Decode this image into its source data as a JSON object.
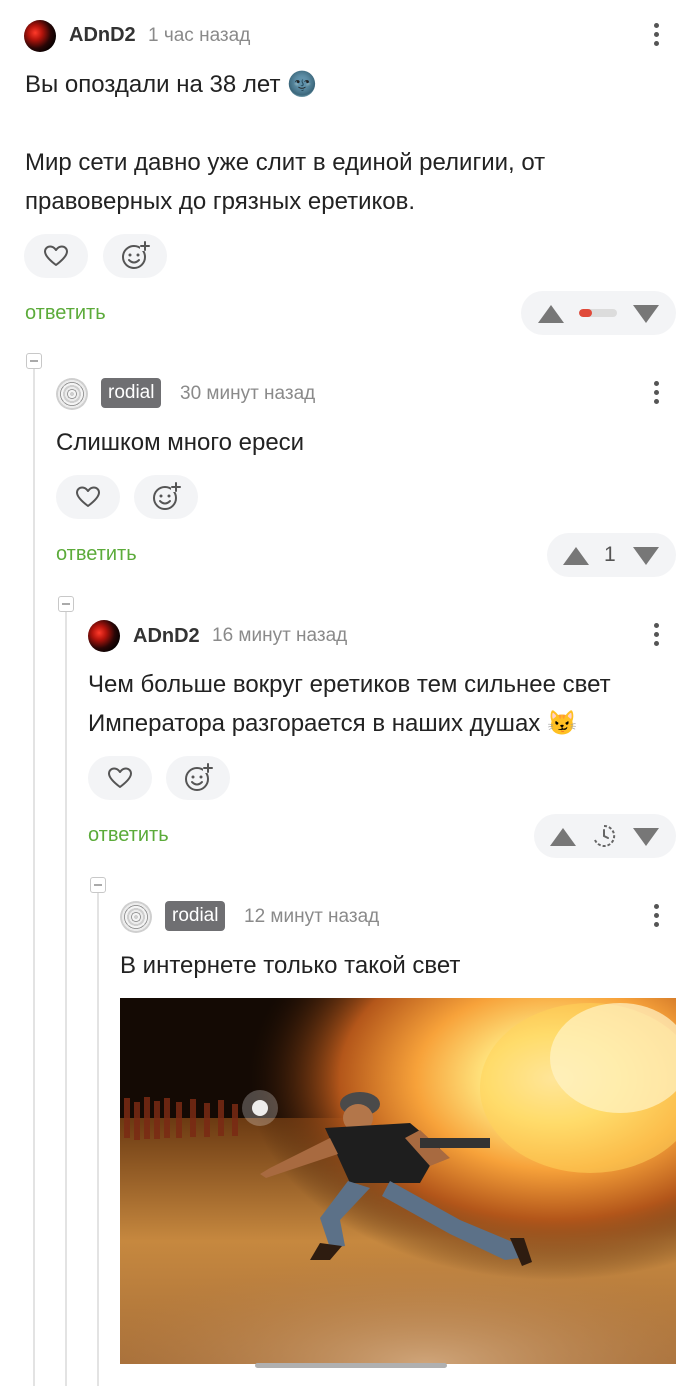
{
  "comments": [
    {
      "author": "ADnD2",
      "time": "1 час назад",
      "text_lines": [
        "Вы опоздали на 38 лет 🌚",
        "",
        "Мир сети давно уже слит в единой религии, от",
        "правоверных до грязных еретиков."
      ],
      "reply_label": "ответить",
      "rating": ""
    },
    {
      "author": "rodial",
      "time": "30 минут назад",
      "text_lines": [
        "Слишком много ереси"
      ],
      "reply_label": "ответить",
      "rating": "1"
    },
    {
      "author": "ADnD2",
      "time": "16 минут назад",
      "text_lines": [
        "Чем больше вокруг еретиков тем сильнее свет",
        "Императора разгорается в наших душах 😼"
      ],
      "reply_label": "ответить",
      "rating": ""
    },
    {
      "author": "rodial",
      "time": "12 минут назад",
      "text_lines": [
        "В интернете только такой свет"
      ],
      "has_image": true
    }
  ],
  "icons": {
    "like": "heart-icon",
    "reaction": "add-reaction-icon",
    "upvote": "arrow-up-icon",
    "downvote": "arrow-down-icon",
    "more": "more-vertical-icon",
    "collapse": "collapse-icon",
    "pending": "clock-icon"
  },
  "colors": {
    "reply": "#5cab3a",
    "badge": "#6f6f72",
    "rating_bar_negative": "#e04a3a"
  }
}
